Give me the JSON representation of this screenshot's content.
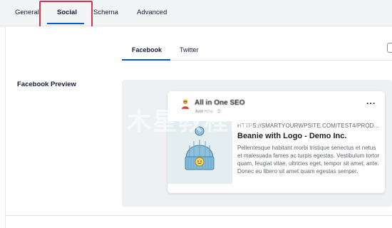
{
  "main_tabs": [
    {
      "label": "General"
    },
    {
      "label": "Social",
      "active": true
    },
    {
      "label": "Schema"
    },
    {
      "label": "Advanced"
    }
  ],
  "sub_tabs": [
    {
      "label": "Facebook",
      "active": true
    },
    {
      "label": "Twitter"
    }
  ],
  "section": {
    "label": "Facebook Preview"
  },
  "preview": {
    "site_name": "All in One SEO",
    "site_meta": "Just now · ⚙",
    "more_icon": "more-horizontal-icon",
    "url": "HTTPS://SMARTYOURWPSITE.COM/TEST4/PRODUCT/...",
    "title": "Beanie with Logo - Demo Inc.",
    "description": "Pellentesque habitant morbi tristique senectus et netus et malesuada fames ac turpis egestas. Vestibulum tortor quam, feugiat vitae, ultricies eget, tempor sit amet, ante. Donec eu libero sit amet quam egestas semper."
  },
  "watermark": "木星教程网",
  "colors": {
    "accent": "#005ae0",
    "highlight": "#e0304c",
    "beanie": "#7fb8d8"
  }
}
